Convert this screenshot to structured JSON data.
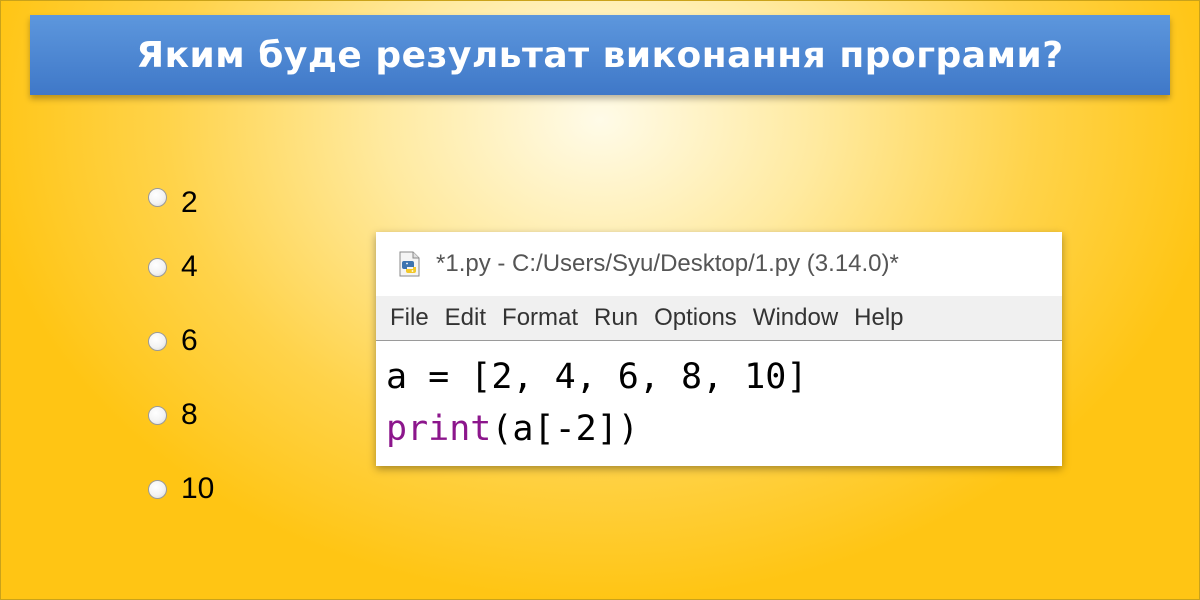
{
  "question": {
    "title": "Яким буде результат виконання програми?"
  },
  "options": [
    {
      "label": "2",
      "selected": false
    },
    {
      "label": "4",
      "selected": false
    },
    {
      "label": "6",
      "selected": false
    },
    {
      "label": "8",
      "selected": false
    },
    {
      "label": "10",
      "selected": false
    }
  ],
  "editor": {
    "icon": "python-file-icon",
    "window_title": "*1.py - C:/Users/Syu/Desktop/1.py (3.14.0)*",
    "menu": [
      "File",
      "Edit",
      "Format",
      "Run",
      "Options",
      "Window",
      "Help"
    ],
    "code": {
      "line1": "a = [2, 4, 6, 8, 10]",
      "line2_keyword": "print",
      "line2_rest": "(a[-2])"
    }
  },
  "colors": {
    "title_bar": "#4a86d2",
    "background": "#ffc514",
    "keyword": "#8c168c"
  }
}
